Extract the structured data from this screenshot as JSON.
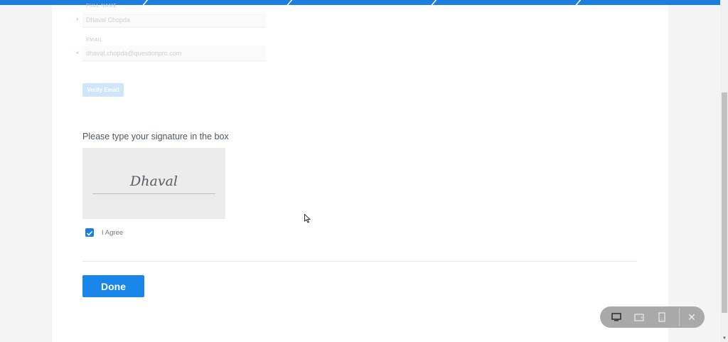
{
  "form": {
    "full_name": {
      "label": "FULL NAME",
      "value": "Dhaval Chopda",
      "required_mark": "*"
    },
    "email": {
      "label": "EMAIL",
      "value": "dhaval.chopda@questionpro.com",
      "required_mark": "*"
    },
    "verify_label": "Verify Email"
  },
  "signature": {
    "prompt": "Please type your signature in the box",
    "value": "Dhaval",
    "agree_label": "I Agree",
    "agree_checked": true
  },
  "done_label": "Done",
  "device_toolbar": {
    "items": [
      "desktop-icon",
      "tablet-icon",
      "mobile-icon",
      "close-icon"
    ],
    "close_glyph": "✕"
  },
  "colors": {
    "accent": "#1a86ea",
    "topbar": "#1a7fde"
  }
}
